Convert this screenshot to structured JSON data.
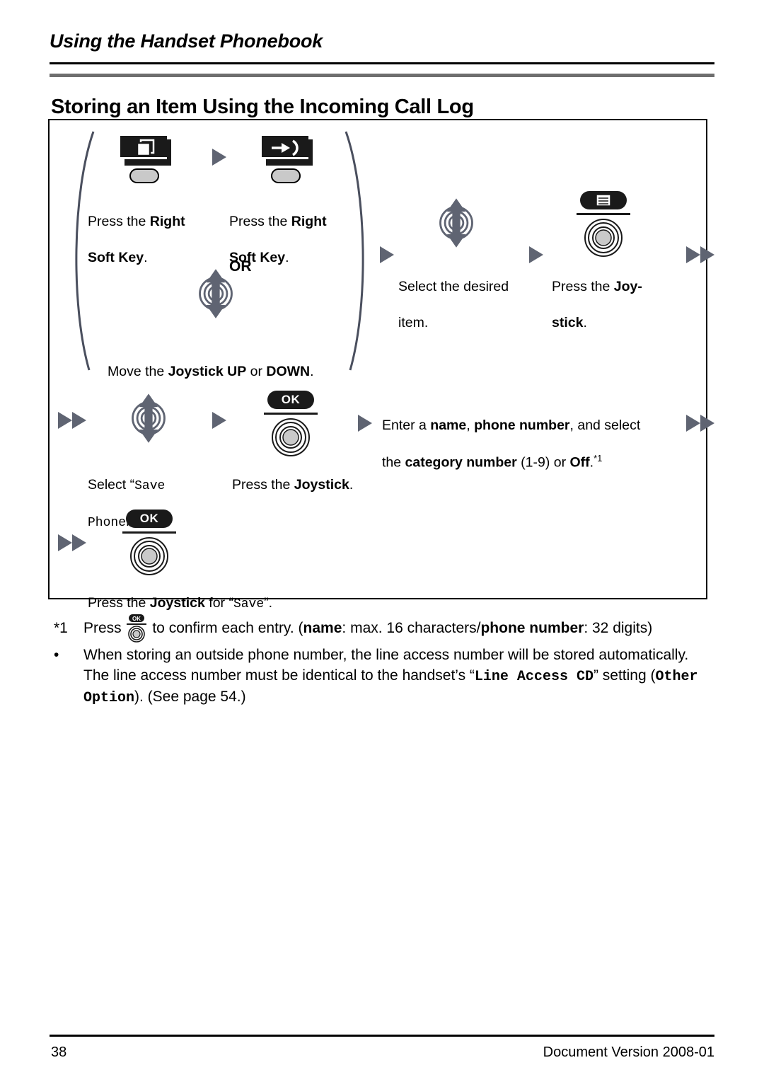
{
  "header": {
    "running_head": "Using the Handset Phonebook",
    "title": "Storing an Item Using the Incoming Call Log"
  },
  "diagram": {
    "steps": {
      "step1_line1": "Press the ",
      "step1_bold": "Right",
      "step1_line2_bold": "Soft Key",
      "step1_period": ".",
      "step2_line1": "Press the ",
      "step2_bold": "Right",
      "step2_line2_bold": "Soft Key",
      "step2_period": ".",
      "or_label": "OR",
      "move_joystick_prefix": "Move the ",
      "move_joystick_bold": "Joystick UP",
      "move_joystick_mid": " or ",
      "move_joystick_bold2": "DOWN",
      "move_joystick_suffix": ".",
      "select_item_line1": "Select the desired",
      "select_item_line2": "item.",
      "press_joystick_prefix": "Press the ",
      "press_joystick_bold_l1": "Joy-",
      "press_joystick_bold_l2": "stick",
      "press_joystick_suffix": ".",
      "select_save_prefix": "Select “",
      "select_save_mono_l1": "Save",
      "select_save_mono_l2": "Phonebook",
      "select_save_suffix": "”.",
      "press_joystick2_prefix": "Press the ",
      "press_joystick2_bold": "Joystick",
      "press_joystick2_suffix": ".",
      "enter_line1_a": "Enter a ",
      "enter_line1_b": "name",
      "enter_line1_c": ", ",
      "enter_line1_d": "phone number",
      "enter_line1_e": ", and select",
      "enter_line2_a": "the ",
      "enter_line2_b": "category number",
      "enter_line2_c": " (1-9) or ",
      "enter_line2_d": "Off",
      "enter_line2_e": ".",
      "enter_line2_sup": "*1",
      "final_prefix": "Press the ",
      "final_bold": "Joystick",
      "final_mid": " for “",
      "final_mono": "Save",
      "final_suffix": "”."
    },
    "icons": {
      "softkey_1": "window-softkey-icon",
      "softkey_2": "incoming-call-log-softkey-icon",
      "joystick_updown": "joystick-up-down-icon",
      "joystick_press_menu": "joystick-press-menu-icon",
      "joystick_press_ok": "joystick-press-ok-icon",
      "ok_label": "OK",
      "arrow_single": "flow-arrow-icon",
      "arrow_double": "flow-arrow-double-icon"
    }
  },
  "notes": {
    "footnote_marker": "*1",
    "footnote_a": "Press ",
    "footnote_b": " to confirm each entry. (",
    "footnote_name": "name",
    "footnote_c": ": max. 16 characters/",
    "footnote_phone": "phone number",
    "footnote_d": ": 32 digits)",
    "bullet_marker": "•",
    "bullet_a": "When storing an outside phone number, the line access number will be stored automatically. The line access number must be identical to the handset’s “",
    "bullet_mono1": "Line Access CD",
    "bullet_b": "” setting (",
    "bullet_mono2": "Other Option",
    "bullet_c": "). (See page 54.)"
  },
  "footer": {
    "page_number": "38",
    "document_version": "Document Version 2008-01"
  },
  "colors": {
    "ink": "#000000",
    "rule_gray": "#6e6e6e",
    "icon_gray": "#5f6472",
    "button_fill": "#c9c9c9",
    "icon_black": "#1a1a1a"
  }
}
